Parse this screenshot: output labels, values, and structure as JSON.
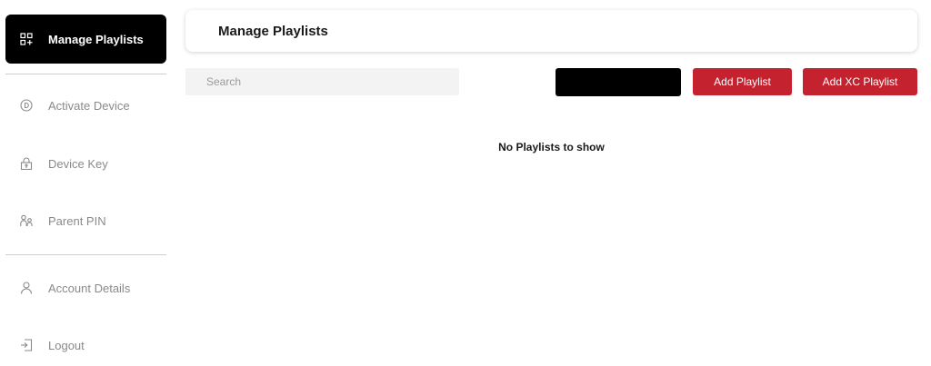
{
  "sidebar": {
    "items": [
      {
        "label": "Manage Playlists",
        "icon": "grid-plus-icon",
        "active": true
      },
      {
        "label": "Activate Device",
        "icon": "circle-d-icon"
      },
      {
        "label": "Device Key",
        "icon": "lock-key-icon"
      },
      {
        "label": "Parent PIN",
        "icon": "parent-child-icon"
      },
      {
        "label": "Account Details",
        "icon": "user-icon"
      },
      {
        "label": "Logout",
        "icon": "logout-icon"
      }
    ]
  },
  "header": {
    "title": "Manage Playlists"
  },
  "toolbar": {
    "search_placeholder": "Search",
    "add_playlist_label": "Add Playlist",
    "add_xc_playlist_label": "Add XC Playlist"
  },
  "main": {
    "empty_message": "No Playlists to show"
  },
  "colors": {
    "accent": "#c4222e",
    "active_nav": "#000000",
    "muted_text": "#8a8a8a"
  }
}
